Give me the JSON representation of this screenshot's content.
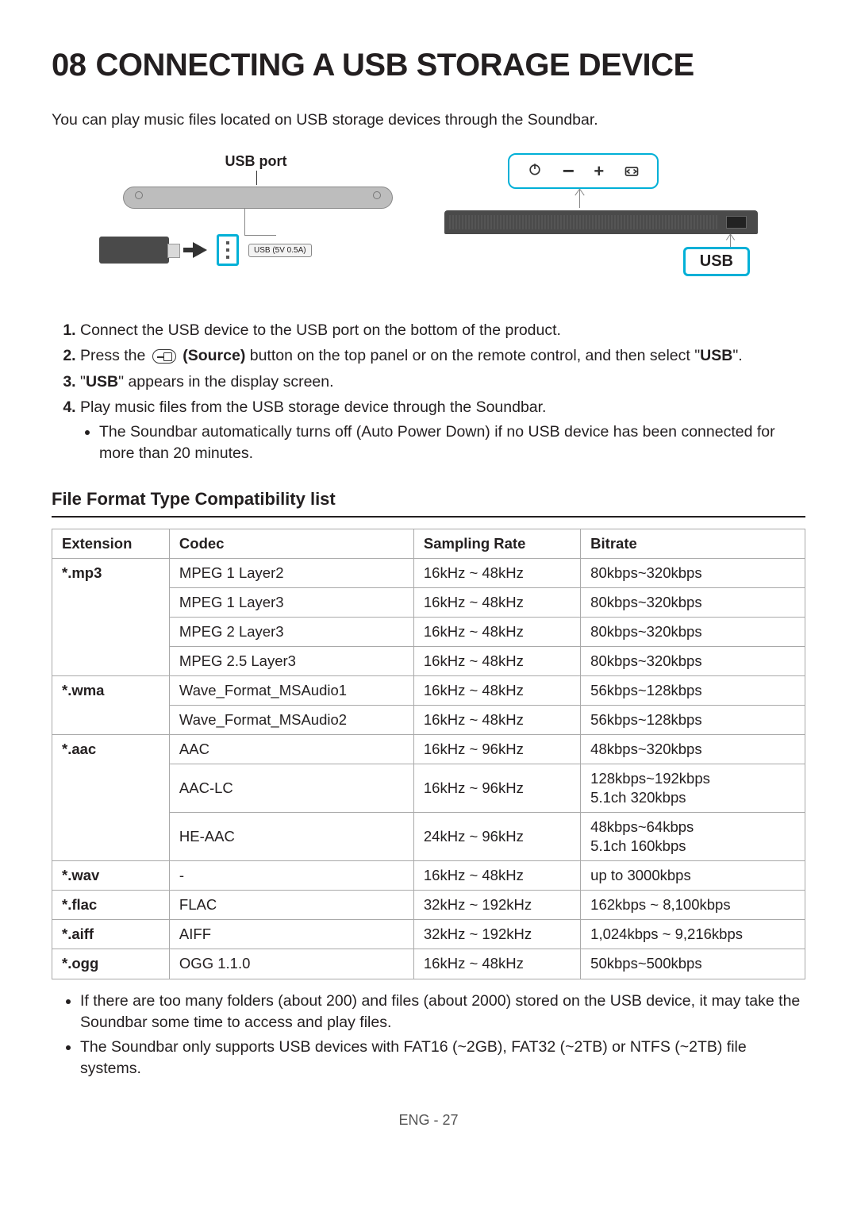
{
  "heading_num": "08",
  "heading_text": "CONNECTING A USB STORAGE DEVICE",
  "intro": "You can play music files located on USB storage devices through the Soundbar.",
  "dia_left": {
    "port_label": "USB port",
    "usb_spec": "USB (5V 0.5A)"
  },
  "dia_right": {
    "usb_badge": "USB"
  },
  "steps": [
    {
      "text": "Connect the USB device to the USB port on the bottom of the product."
    },
    {
      "pre": "Press the ",
      "bold": "(Source)",
      "post": " button on the top panel or on the remote control, and then select \"",
      "tail_bold": "USB",
      "tail_post": "\"."
    },
    {
      "pre": "\"",
      "bold": "USB",
      "post": "\" appears in the display screen."
    },
    {
      "text": "Play music files from the USB storage device through the Soundbar.",
      "sub": [
        "The Soundbar automatically turns off (Auto Power Down) if no USB device has been connected for more than 20 minutes."
      ]
    }
  ],
  "compat_heading": "File Format Type Compatibility list",
  "table": {
    "headers": [
      "Extension",
      "Codec",
      "Sampling Rate",
      "Bitrate"
    ],
    "rows": [
      {
        "ext": "*.mp3",
        "rowspan": 4,
        "codec": "MPEG 1 Layer2",
        "rate": "16kHz ~ 48kHz",
        "bitrate": "80kbps~320kbps"
      },
      {
        "codec": "MPEG 1 Layer3",
        "rate": "16kHz ~ 48kHz",
        "bitrate": "80kbps~320kbps"
      },
      {
        "codec": "MPEG 2 Layer3",
        "rate": "16kHz ~ 48kHz",
        "bitrate": "80kbps~320kbps"
      },
      {
        "codec": "MPEG 2.5 Layer3",
        "rate": "16kHz ~ 48kHz",
        "bitrate": "80kbps~320kbps"
      },
      {
        "ext": "*.wma",
        "rowspan": 2,
        "codec": "Wave_Format_MSAudio1",
        "rate": "16kHz ~ 48kHz",
        "bitrate": "56kbps~128kbps"
      },
      {
        "codec": "Wave_Format_MSAudio2",
        "rate": "16kHz ~ 48kHz",
        "bitrate": "56kbps~128kbps"
      },
      {
        "ext": "*.aac",
        "rowspan": 3,
        "codec": "AAC",
        "rate": "16kHz ~ 96kHz",
        "bitrate": "48kbps~320kbps"
      },
      {
        "codec": "AAC-LC",
        "rate": "16kHz ~ 96kHz",
        "bitrate": "128kbps~192kbps\n5.1ch 320kbps"
      },
      {
        "codec": "HE-AAC",
        "rate": "24kHz ~ 96kHz",
        "bitrate": "48kbps~64kbps\n5.1ch 160kbps"
      },
      {
        "ext": "*.wav",
        "rowspan": 1,
        "codec": "-",
        "rate": "16kHz ~ 48kHz",
        "bitrate": "up to 3000kbps"
      },
      {
        "ext": "*.flac",
        "rowspan": 1,
        "codec": "FLAC",
        "rate": "32kHz ~ 192kHz",
        "bitrate": "162kbps ~ 8,100kbps"
      },
      {
        "ext": "*.aiff",
        "rowspan": 1,
        "codec": "AIFF",
        "rate": "32kHz ~ 192kHz",
        "bitrate": "1,024kbps ~ 9,216kbps"
      },
      {
        "ext": "*.ogg",
        "rowspan": 1,
        "codec": "OGG 1.1.0",
        "rate": "16kHz ~ 48kHz",
        "bitrate": "50kbps~500kbps"
      }
    ]
  },
  "notes": [
    "If there are too many folders (about 200) and files (about 2000) stored on the USB device, it may take the Soundbar some time to access and play files.",
    "The Soundbar only supports USB devices with FAT16 (~2GB), FAT32 (~2TB) or NTFS (~2TB) file systems."
  ],
  "footer": "ENG - 27"
}
